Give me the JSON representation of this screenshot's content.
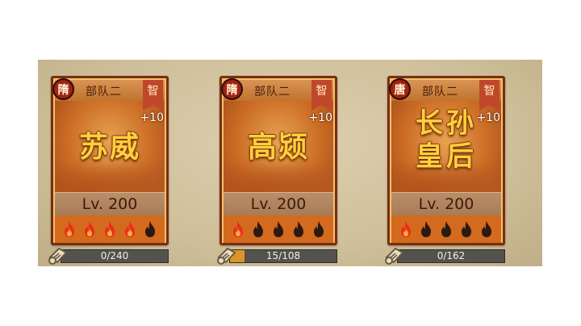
{
  "cards": [
    {
      "seal": "隋",
      "troop_label": "部队二",
      "attr": "智",
      "bonus": "+10",
      "name_lines": [
        "苏威"
      ],
      "level_label": "Lv. 200",
      "stars_lit": 4,
      "stars_total": 5,
      "fragments": "0/240",
      "fragments_have": 0,
      "fragments_need": 240
    },
    {
      "seal": "隋",
      "troop_label": "部队二",
      "attr": "智",
      "bonus": "+10",
      "name_lines": [
        "高颎"
      ],
      "level_label": "Lv. 200",
      "stars_lit": 1,
      "stars_total": 5,
      "fragments": "15/108",
      "fragments_have": 15,
      "fragments_need": 108
    },
    {
      "seal": "唐",
      "troop_label": "部队二",
      "attr": "智",
      "bonus": "+10",
      "name_lines": [
        "长孙",
        "皇后"
      ],
      "level_label": "Lv. 200",
      "stars_lit": 1,
      "stars_total": 5,
      "fragments": "0/162",
      "fragments_have": 0,
      "fragments_need": 162
    }
  ],
  "colors": {
    "flame_lit_outer": "#e8301c",
    "flame_lit_inner": "#ffb13a",
    "flame_dark": "#2a1a10",
    "progress_fill": "#d9952a"
  },
  "icons": {
    "star": "flame-star-icon",
    "fragment": "fragment-scroll-icon"
  }
}
